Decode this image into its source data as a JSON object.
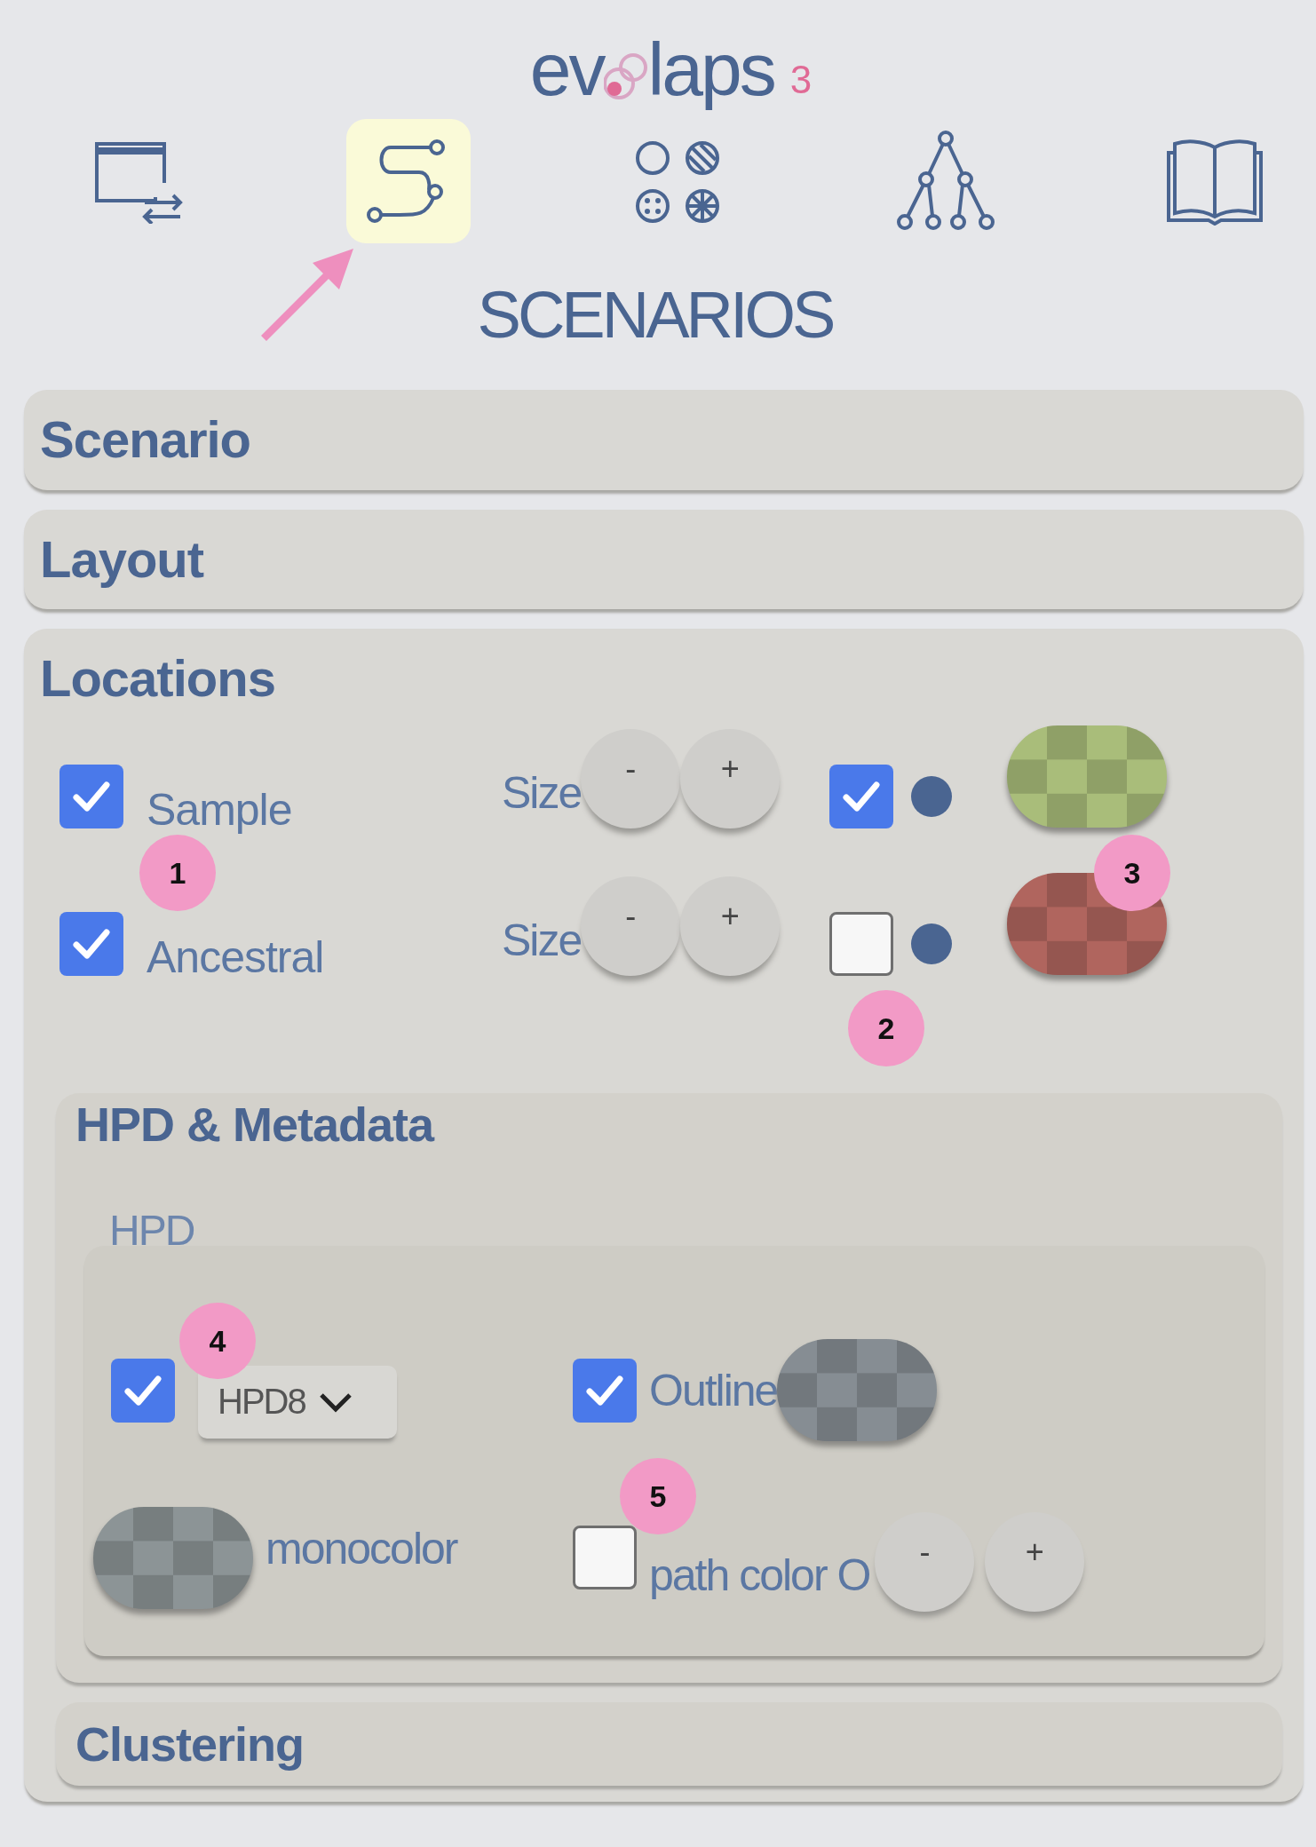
{
  "logo": {
    "prefix": "ev",
    "suffix": "laps",
    "version": "3"
  },
  "nav": [
    {
      "kind": "window",
      "selected": false
    },
    {
      "kind": "path",
      "selected": true
    },
    {
      "kind": "patterns",
      "selected": false
    },
    {
      "kind": "tree",
      "selected": false
    },
    {
      "kind": "book",
      "selected": false
    }
  ],
  "page_title": "SCENARIOS",
  "sections": [
    {
      "title": "Scenario",
      "expanded": false
    },
    {
      "title": "Layout",
      "expanded": false
    },
    {
      "title": "Locations",
      "expanded": true
    }
  ],
  "locations": {
    "rows": [
      {
        "label": "Sample",
        "checked": true,
        "size_label": "Size",
        "minus": "-",
        "plus": "+",
        "dot_checked": true,
        "color": "#a9bd7a"
      },
      {
        "label": "Ancestral",
        "checked": true,
        "size_label": "Size",
        "minus": "-",
        "plus": "+",
        "dot_checked": false,
        "color": "#b0655e"
      }
    ],
    "subsections": [
      {
        "title": "HPD & Metadata",
        "expanded": true
      },
      {
        "title": "Clustering",
        "expanded": false
      }
    ],
    "hpd": {
      "legend": "HPD",
      "enabled": true,
      "select_value": "HPD8",
      "outline": {
        "label": "Outline",
        "checked": true,
        "color": "#868d93"
      },
      "monocolor": {
        "label": "monocolor",
        "color": "#8c9496"
      },
      "path_color": {
        "label": "path color O",
        "checked": false,
        "minus": "-",
        "plus": "+"
      }
    }
  },
  "annotations": [
    {
      "label": "1"
    },
    {
      "label": "2"
    },
    {
      "label": "3"
    },
    {
      "label": "4"
    },
    {
      "label": "5"
    }
  ]
}
